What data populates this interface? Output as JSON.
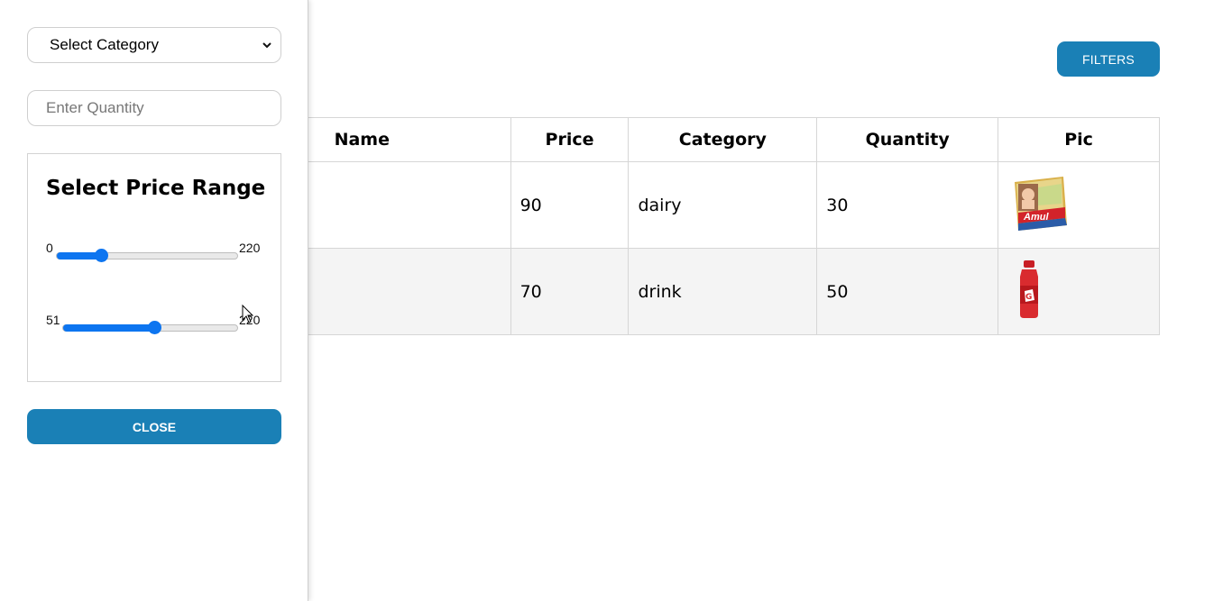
{
  "header": {
    "filters_label": "FILTERS"
  },
  "table": {
    "headers": {
      "name": "Name",
      "price": "Price",
      "category": "Category",
      "quantity": "Quantity",
      "pic": "Pic"
    },
    "rows": [
      {
        "name": "",
        "price": "90",
        "category": "dairy",
        "quantity": "30",
        "pic": "cheese-pack-image"
      },
      {
        "name": "",
        "price": "70",
        "category": "drink",
        "quantity": "50",
        "pic": "sports-drink-bottle-image"
      }
    ]
  },
  "sidebar": {
    "category_select": {
      "selected": "Select Category"
    },
    "quantity_input": {
      "placeholder": "Enter Quantity",
      "value": ""
    },
    "price_range": {
      "title": "Select Price Range",
      "slider_min": {
        "min_label": "0",
        "max_label": "220",
        "value": 0.24
      },
      "slider_max": {
        "min_label": "51",
        "max_label": "220",
        "value": 0.52
      }
    },
    "close_label": "CLOSE"
  },
  "colors": {
    "accent": "#1a80b6",
    "slider": "#0d75f0"
  }
}
